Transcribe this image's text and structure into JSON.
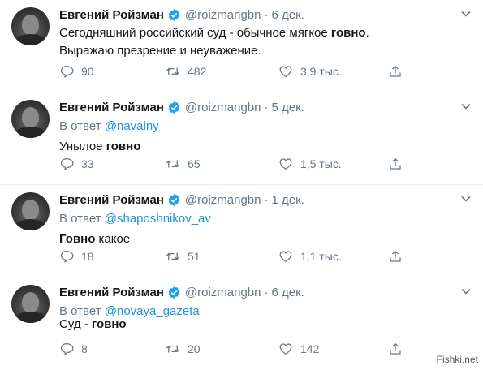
{
  "tweets": [
    {
      "name": "Евгений Ройзман",
      "handle": "@roizmangbn",
      "separator": "·",
      "time": "6 дек.",
      "reply_prefix": "",
      "reply_to": "",
      "line1_parts": [
        "Сегодняшний российский суд - обычное мягкое ",
        "говно",
        "."
      ],
      "line2": "Выражаю презрение и неуважение.",
      "replies": "90",
      "retweets": "482",
      "likes": "3,9 тыс."
    },
    {
      "name": "Евгений Ройзман",
      "handle": "@roizmangbn",
      "separator": "·",
      "time": "5 дек.",
      "reply_prefix": "В ответ",
      "reply_to": "@navalny",
      "line1_parts": [
        "Унылое ",
        "говно",
        ""
      ],
      "line2": "",
      "replies": "33",
      "retweets": "65",
      "likes": "1,5 тыс."
    },
    {
      "name": "Евгений Ройзман",
      "handle": "@roizmangbn",
      "separator": "·",
      "time": "1 дек.",
      "reply_prefix": "В ответ",
      "reply_to": "@shaposhnikov_av",
      "line1_parts": [
        "",
        "Говно",
        " какое"
      ],
      "line2": "",
      "replies": "18",
      "retweets": "51",
      "likes": "1,1 тыс."
    },
    {
      "name": "Евгений Ройзман",
      "handle": "@roizmangbn",
      "separator": "·",
      "time": "6 дек.",
      "reply_prefix": "В ответ",
      "reply_to": "@novaya_gazeta",
      "line1_parts": [
        "Суд - ",
        "говно",
        ""
      ],
      "line2": "",
      "replies": "8",
      "retweets": "20",
      "likes": "142"
    }
  ],
  "icons": {
    "verified": "verified-badge-icon",
    "menu": "chevron-down-icon",
    "reply": "reply-bubble-icon",
    "retweet": "retweet-arrows-icon",
    "like": "heart-icon",
    "share": "share-upload-icon"
  },
  "colors": {
    "verified": "#1da1f2",
    "mention": "#1b95e0",
    "muted": "#657786",
    "divider": "#e6ecf0"
  },
  "watermark": "Fishki.net"
}
